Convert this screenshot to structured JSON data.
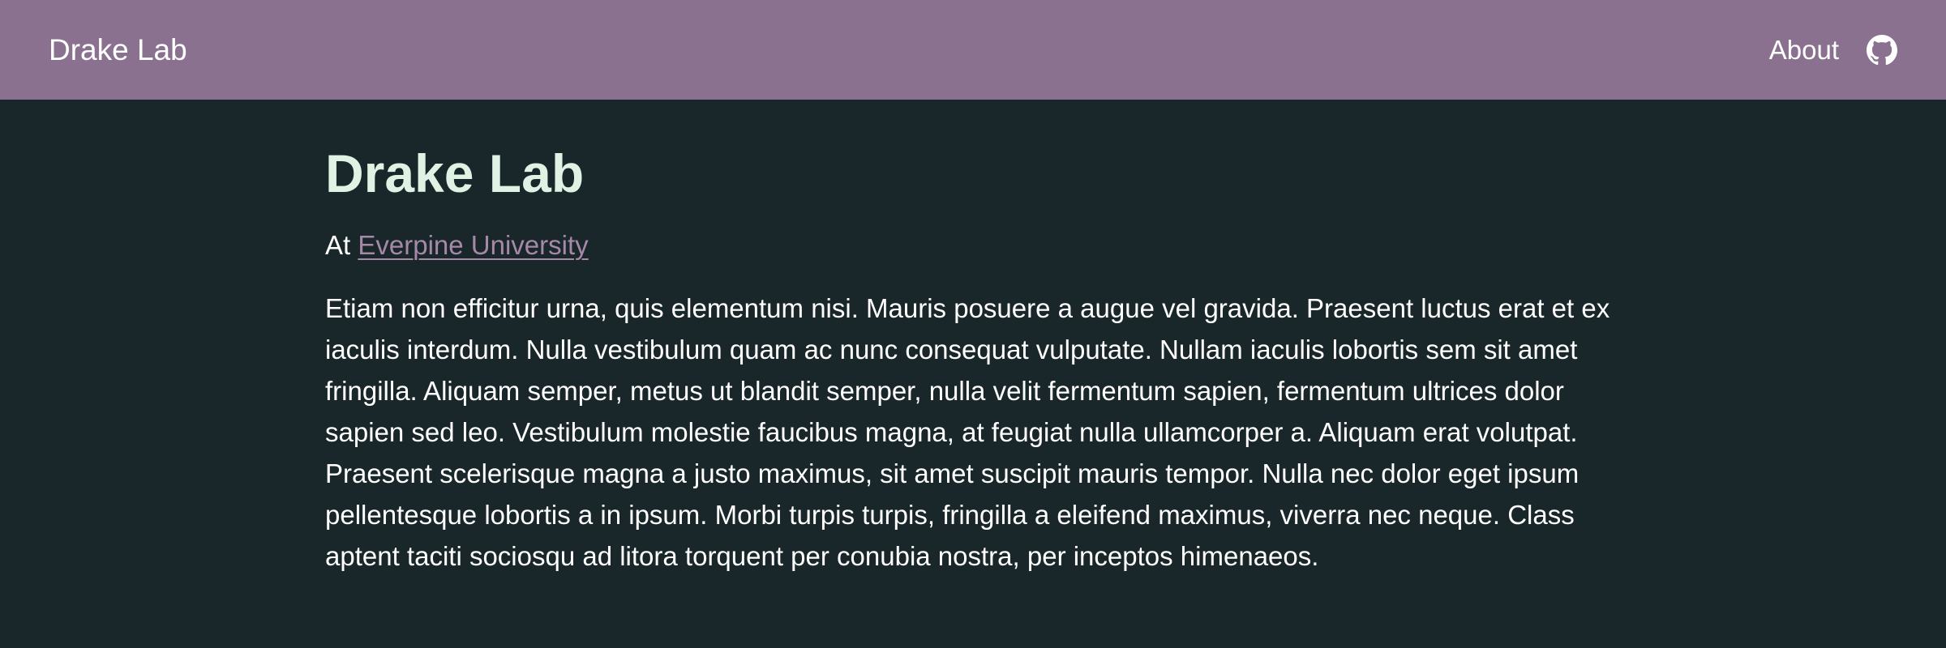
{
  "navbar": {
    "brand": "Drake Lab",
    "links": [
      {
        "label": "About"
      }
    ],
    "github_icon": "github-icon"
  },
  "main": {
    "title": "Drake Lab",
    "affiliation_prefix": "At",
    "affiliation_link": "Everpine University",
    "paragraph": "Etiam non efficitur urna, quis elementum nisi. Mauris posuere a augue vel gravida. Praesent luctus erat et ex iaculis interdum. Nulla vestibulum quam ac nunc consequat vulputate. Nullam iaculis lobortis sem sit amet fringilla. Aliquam semper, metus ut blandit semper, nulla velit fermentum sapien, fermentum ultrices dolor sapien sed leo. Vestibulum molestie faucibus magna, at feugiat nulla ullamcorper a. Aliquam erat volutpat. Praesent scelerisque magna a justo maximus, sit amet suscipit mauris tempor. Nulla nec dolor eget ipsum pellentesque lobortis a in ipsum. Morbi turpis turpis, fringilla a eleifend maximus, viverra nec neque. Class aptent taciti sociosqu ad litora torquent per conubia nostra, per inceptos himenaeos."
  },
  "colors": {
    "navbar_bg": "#8a7190",
    "page_bg": "#19272a",
    "title": "#dff2e4",
    "link": "#a688a8",
    "text": "#ffffff"
  }
}
